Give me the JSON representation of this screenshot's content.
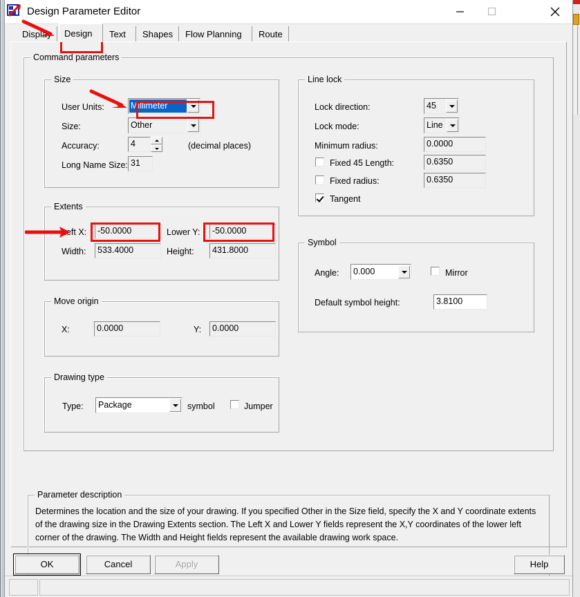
{
  "window": {
    "title": "Design Parameter Editor",
    "icon": "app-icon",
    "minimize": "minimize",
    "maximize": "maximize",
    "close": "close"
  },
  "tabs": [
    {
      "label": "Display",
      "selected": false
    },
    {
      "label": "Design",
      "selected": true
    },
    {
      "label": "Text",
      "selected": false
    },
    {
      "label": "Shapes",
      "selected": false
    },
    {
      "label": "Flow Planning",
      "selected": false
    },
    {
      "label": "Route",
      "selected": false
    }
  ],
  "command_parameters": {
    "legend": "Command parameters",
    "size": {
      "legend": "Size",
      "user_units_label": "User Units:",
      "user_units_value": "Millimeter",
      "size_label": "Size:",
      "size_value": "Other",
      "accuracy_label": "Accuracy:",
      "accuracy_value": "4",
      "accuracy_suffix": "(decimal places)",
      "long_name_size_label": "Long Name Size:",
      "long_name_size_value": "31"
    },
    "extents": {
      "legend": "Extents",
      "left_x_label": "Left X:",
      "left_x_value": "-50.0000",
      "lower_y_label": "Lower Y:",
      "lower_y_value": "-50.0000",
      "width_label": "Width:",
      "width_value": "533.4000",
      "height_label": "Height:",
      "height_value": "431.8000"
    },
    "move_origin": {
      "legend": "Move origin",
      "x_label": "X:",
      "x_value": "0.0000",
      "y_label": "Y:",
      "y_value": "0.0000"
    },
    "drawing_type": {
      "legend": "Drawing type",
      "type_label": "Type:",
      "type_value": "Package",
      "symbol_label": "symbol",
      "jumper_label": "Jumper",
      "jumper_checked": false
    },
    "line_lock": {
      "legend": "Line lock",
      "lock_direction_label": "Lock direction:",
      "lock_direction_value": "45",
      "lock_mode_label": "Lock mode:",
      "lock_mode_value": "Line",
      "minimum_radius_label": "Minimum radius:",
      "minimum_radius_value": "0.0000",
      "fixed_45_length_label": "Fixed 45 Length:",
      "fixed_45_length_value": "0.6350",
      "fixed_45_length_checked": false,
      "fixed_radius_label": "Fixed radius:",
      "fixed_radius_value": "0.6350",
      "fixed_radius_checked": false,
      "tangent_label": "Tangent",
      "tangent_checked": true
    },
    "symbol": {
      "legend": "Symbol",
      "angle_label": "Angle:",
      "angle_value": "0.000",
      "mirror_label": "Mirror",
      "mirror_checked": false,
      "default_symbol_height_label": "Default symbol height:",
      "default_symbol_height_value": "3.8100"
    }
  },
  "parameter_description": {
    "legend": "Parameter description",
    "text": "Determines the location and the size of your drawing.  If you specified Other in the Size field, specify the X and Y coordinate extents of the drawing size in the Drawing Extents section. The Left X and Lower Y fields represent the X,Y coordinates of the lower left corner of the drawing.  The Width and Height fields represent the available drawing work space."
  },
  "buttons": {
    "ok": "OK",
    "cancel": "Cancel",
    "apply": "Apply",
    "help": "Help"
  },
  "colors": {
    "annotation": "#e81010",
    "selection": "#0a64c8",
    "dialog_face": "#f0f0f0"
  }
}
